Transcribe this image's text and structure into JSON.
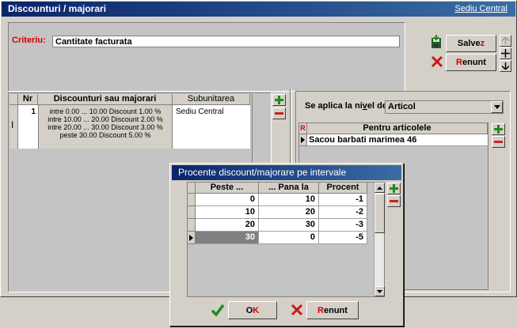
{
  "window": {
    "title": "Discounturi / majorari",
    "link": "Sediu Central"
  },
  "criteriu": {
    "label": "Criteriu:",
    "value": "Cantitate facturata"
  },
  "buttons": {
    "save": {
      "pre": "Salve",
      "hot": "z",
      "post": ""
    },
    "cancel": {
      "pre": "",
      "hot": "R",
      "post": "enunt"
    }
  },
  "left_grid": {
    "headers": [
      "Nr",
      "Discounturi sau majorari",
      "Subunitarea"
    ],
    "row": {
      "nr": "1",
      "lines": [
        "intre 0.00 ... 10.00 Discount 1.00 %",
        "intre 10.00 ... 20.00 Discount 2.00 %",
        "intre 20.00 ... 30.00 Discount 3.00 %",
        "peste 30.00 Discount 5.00 %"
      ],
      "subunitate": "Sediu Central"
    }
  },
  "right_panel": {
    "aplica_label_pre": "Se aplica la ni",
    "aplica_label_hot": "v",
    "aplica_label_post": "el de",
    "level_value": "Articol",
    "marker": "R",
    "header": "Pentru articolele",
    "items": [
      "Sacou barbati marimea 46"
    ]
  },
  "dialog": {
    "title": "Procente discount/majorare pe intervale",
    "headers": [
      "Peste ...",
      "... Pana la",
      "Procent"
    ],
    "rows": [
      {
        "peste": "0",
        "pana": "10",
        "procent": "-1"
      },
      {
        "peste": "10",
        "pana": "20",
        "procent": "-2"
      },
      {
        "peste": "20",
        "pana": "30",
        "procent": "-3"
      },
      {
        "peste": "30",
        "pana": "0",
        "procent": "-5"
      }
    ],
    "ok": {
      "pre": "O",
      "hot": "K",
      "post": ""
    },
    "cancel": {
      "pre": "",
      "hot": "R",
      "post": "enunt"
    }
  },
  "colors": {
    "title_start": "#0a246a",
    "title_end": "#3a6ea5",
    "hotkey": "#d00000",
    "plus": "#1f8a1f",
    "minus": "#cc2020"
  }
}
